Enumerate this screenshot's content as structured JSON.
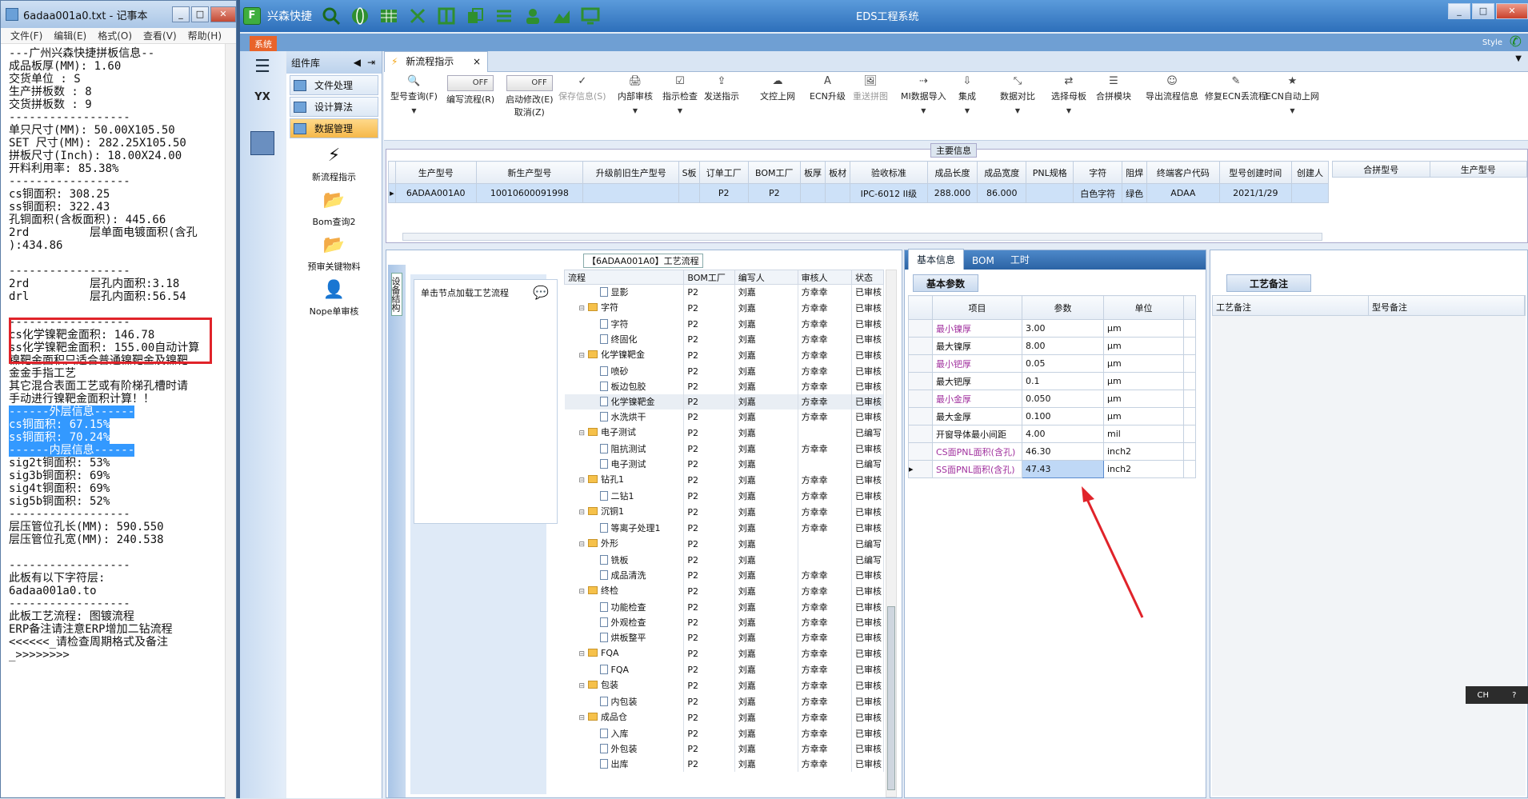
{
  "notepad": {
    "title": "6adaa001a0.txt - 记事本",
    "menu": [
      "文件(F)",
      "编辑(E)",
      "格式(O)",
      "查看(V)",
      "帮助(H)"
    ],
    "lines": [
      "---广州兴森快捷拼板信息--",
      "成品板厚(MM): 1.60",
      "交货单位 : S",
      "生产拼板数 : 8",
      "交货拼板数 : 9",
      "------------------",
      "单只尺寸(MM): 50.00X105.50",
      "SET 尺寸(MM): 282.25X105.50",
      "拼板尺寸(Inch): 18.00X24.00",
      "开料利用率: 85.38%",
      "------------------",
      "cs铜面积: 308.25",
      "ss铜面积: 322.43",
      "孔铜面积(含板面积): 445.66",
      "2rd         层单面电镀面积(含孔",
      "):434.86",
      "",
      "------------------",
      "2rd         层孔内面积:3.18",
      "drl         层孔内面积:56.54",
      "",
      "------------------",
      "cs化学镍靶金面积: 146.78",
      "ss化学镍靶金面积: 155.00自动计算",
      "镍靶金面积只适合普通镍靶金及镍靶",
      "金金手指工艺",
      "其它混合表面工艺或有阶梯孔槽时请",
      "手动进行镍靶金面积计算！！",
      "------外层信息------",
      "cs铜面积: 67.15%",
      "ss铜面积: 70.24%",
      "------内层信息------",
      "sig2t铜面积: 53%",
      "sig3b铜面积: 69%",
      "sig4t铜面积: 69%",
      "sig5b铜面积: 52%",
      "------------------",
      "层压管位孔长(MM): 590.550",
      "层压管位孔宽(MM): 240.538",
      "",
      "------------------",
      "此板有以下字符层:",
      "6adaa001a0.to",
      "------------------",
      "此板工艺流程: 图镀流程",
      "ERP备注请注意ERP增加二钻流程",
      "<<<<<<_请检查周期格式及备注",
      "_>>>>>>>>"
    ]
  },
  "app": {
    "brand": "兴森快捷",
    "title": "EDS工程系统",
    "system_tab": "系统",
    "style_label": "Style",
    "window_controls": [
      "_",
      "□",
      "✕"
    ]
  },
  "leftnav": {
    "hamburger": "☰",
    "logo": "YX"
  },
  "component_panel": {
    "header": "组件库",
    "items": [
      "文件处理",
      "设计算法",
      "数据管理"
    ],
    "tools": [
      {
        "label": "新流程指示",
        "icon": "lightning-icon"
      },
      {
        "label": "Bom查询2",
        "icon": "folder-icon"
      },
      {
        "label": "预审关键物料",
        "icon": "folder-icon"
      },
      {
        "label": "Nope单审核",
        "icon": "user-icon"
      }
    ]
  },
  "tabs": [
    {
      "label": "新流程指示"
    }
  ],
  "ribbon": {
    "buttons": [
      {
        "label": "型号查询(F)",
        "dd": true
      },
      {
        "label": "编写流程(R)",
        "toggle": "OFF"
      },
      {
        "label": "启动修改(E)",
        "sub": "取消(Z)",
        "toggle": "OFF"
      },
      {
        "label": "保存信息(S)",
        "disabled": true
      },
      {
        "label": "内部审核",
        "dd": true
      },
      {
        "label": "指示检查",
        "dd": true
      },
      {
        "label": "发送指示"
      },
      {
        "label": "文控上网"
      },
      {
        "label": "ECN升级"
      },
      {
        "label": "重送拼图",
        "disabled": true
      },
      {
        "label": "MI数据导入",
        "dd": true
      },
      {
        "label": "集成",
        "dd": true
      },
      {
        "label": "数据对比",
        "dd": true
      },
      {
        "label": "选择母板",
        "dd": true
      },
      {
        "label": "合拼模块"
      },
      {
        "label": "导出流程信息"
      },
      {
        "label": "修复ECN丢流程"
      },
      {
        "label": "ECN自动上网",
        "dd": true
      }
    ]
  },
  "main_info": {
    "label": "主要信息",
    "columns": [
      "生产型号",
      "新生产型号",
      "升级前旧生产型号",
      "S板",
      "订单工厂",
      "BOM工厂",
      "板厚",
      "板材",
      "验收标准",
      "成品长度",
      "成品宽度",
      "PNL规格",
      "字符",
      "阻焊",
      "终端客户代码",
      "型号创建时间",
      "创建人"
    ],
    "row": [
      "6ADAA001A0",
      "10010600091998",
      "",
      "",
      "P2",
      "P2",
      "",
      "",
      "IPC-6012 II级",
      "288.000",
      "86.000",
      "",
      "白色字符",
      "绿色",
      "ADAA",
      "2021/1/29",
      ""
    ],
    "side_columns": [
      "合拼型号",
      "生产型号"
    ]
  },
  "flow": {
    "title": "【6ADAA001A0】工艺流程",
    "side_tab": "设备结构",
    "tip": "单击节点加载工艺流程",
    "columns": [
      "流程",
      "BOM工厂",
      "编写人",
      "审核人",
      "状态"
    ],
    "rows": [
      {
        "name": "显影",
        "level": 2,
        "f": "P2",
        "w": "刘嘉",
        "a": "方幸幸",
        "s": "已审核"
      },
      {
        "name": "字符",
        "level": 1,
        "f": "P2",
        "w": "刘嘉",
        "a": "方幸幸",
        "s": "已审核"
      },
      {
        "name": "字符",
        "level": 2,
        "f": "P2",
        "w": "刘嘉",
        "a": "方幸幸",
        "s": "已审核"
      },
      {
        "name": "终固化",
        "level": 2,
        "f": "P2",
        "w": "刘嘉",
        "a": "方幸幸",
        "s": "已审核"
      },
      {
        "name": "化学镍靶金",
        "level": 1,
        "f": "P2",
        "w": "刘嘉",
        "a": "方幸幸",
        "s": "已审核"
      },
      {
        "name": "喷砂",
        "level": 2,
        "f": "P2",
        "w": "刘嘉",
        "a": "方幸幸",
        "s": "已审核"
      },
      {
        "name": "板边包胶",
        "level": 2,
        "f": "P2",
        "w": "刘嘉",
        "a": "方幸幸",
        "s": "已审核"
      },
      {
        "name": "化学镍靶金",
        "level": 2,
        "f": "P2",
        "w": "刘嘉",
        "a": "方幸幸",
        "s": "已审核",
        "sel": true
      },
      {
        "name": "水洗烘干",
        "level": 2,
        "f": "P2",
        "w": "刘嘉",
        "a": "方幸幸",
        "s": "已审核"
      },
      {
        "name": "电子测试",
        "level": 1,
        "f": "P2",
        "w": "刘嘉",
        "a": "",
        "s": "已编写"
      },
      {
        "name": "阻抗测试",
        "level": 2,
        "f": "P2",
        "w": "刘嘉",
        "a": "方幸幸",
        "s": "已审核"
      },
      {
        "name": "电子测试",
        "level": 2,
        "f": "P2",
        "w": "刘嘉",
        "a": "",
        "s": "已编写"
      },
      {
        "name": "钻孔1",
        "level": 1,
        "f": "P2",
        "w": "刘嘉",
        "a": "方幸幸",
        "s": "已审核"
      },
      {
        "name": "二钻1",
        "level": 2,
        "f": "P2",
        "w": "刘嘉",
        "a": "方幸幸",
        "s": "已审核"
      },
      {
        "name": "沉铜1",
        "level": 1,
        "f": "P2",
        "w": "刘嘉",
        "a": "方幸幸",
        "s": "已审核"
      },
      {
        "name": "等离子处理1",
        "level": 2,
        "f": "P2",
        "w": "刘嘉",
        "a": "方幸幸",
        "s": "已审核"
      },
      {
        "name": "外形",
        "level": 1,
        "f": "P2",
        "w": "刘嘉",
        "a": "",
        "s": "已编写"
      },
      {
        "name": "铣板",
        "level": 2,
        "f": "P2",
        "w": "刘嘉",
        "a": "",
        "s": "已编写"
      },
      {
        "name": "成品清洗",
        "level": 2,
        "f": "P2",
        "w": "刘嘉",
        "a": "方幸幸",
        "s": "已审核"
      },
      {
        "name": "终检",
        "level": 1,
        "f": "P2",
        "w": "刘嘉",
        "a": "方幸幸",
        "s": "已审核"
      },
      {
        "name": "功能检查",
        "level": 2,
        "f": "P2",
        "w": "刘嘉",
        "a": "方幸幸",
        "s": "已审核"
      },
      {
        "name": "外观检查",
        "level": 2,
        "f": "P2",
        "w": "刘嘉",
        "a": "方幸幸",
        "s": "已审核"
      },
      {
        "name": "烘板整平",
        "level": 2,
        "f": "P2",
        "w": "刘嘉",
        "a": "方幸幸",
        "s": "已审核"
      },
      {
        "name": "FQA",
        "level": 1,
        "f": "P2",
        "w": "刘嘉",
        "a": "方幸幸",
        "s": "已审核"
      },
      {
        "name": "FQA",
        "level": 2,
        "f": "P2",
        "w": "刘嘉",
        "a": "方幸幸",
        "s": "已审核"
      },
      {
        "name": "包装",
        "level": 1,
        "f": "P2",
        "w": "刘嘉",
        "a": "方幸幸",
        "s": "已审核"
      },
      {
        "name": "内包装",
        "level": 2,
        "f": "P2",
        "w": "刘嘉",
        "a": "方幸幸",
        "s": "已审核"
      },
      {
        "name": "成品仓",
        "level": 1,
        "f": "P2",
        "w": "刘嘉",
        "a": "方幸幸",
        "s": "已审核"
      },
      {
        "name": "入库",
        "level": 2,
        "f": "P2",
        "w": "刘嘉",
        "a": "方幸幸",
        "s": "已审核"
      },
      {
        "name": "外包装",
        "level": 2,
        "f": "P2",
        "w": "刘嘉",
        "a": "方幸幸",
        "s": "已审核"
      },
      {
        "name": "出库",
        "level": 2,
        "f": "P2",
        "w": "刘嘉",
        "a": "方幸幸",
        "s": "已审核"
      }
    ]
  },
  "info": {
    "tabs": [
      "基本信息",
      "BOM",
      "工时"
    ],
    "sub": "基本参数",
    "columns": [
      "项目",
      "参数",
      "单位"
    ],
    "rows": [
      {
        "k": "最小镍厚",
        "v": "3.00",
        "u": "μm",
        "p": true
      },
      {
        "k": "最大镍厚",
        "v": "8.00",
        "u": "μm",
        "p": false
      },
      {
        "k": "最小钯厚",
        "v": "0.05",
        "u": "μm",
        "p": true
      },
      {
        "k": "最大钯厚",
        "v": "0.1",
        "u": "μm",
        "p": false
      },
      {
        "k": "最小金厚",
        "v": "0.050",
        "u": "μm",
        "p": true
      },
      {
        "k": "最大金厚",
        "v": "0.100",
        "u": "μm",
        "p": false
      },
      {
        "k": "开窗导体最小间距",
        "v": "4.00",
        "u": "mil",
        "p": false
      },
      {
        "k": "CS面PNL面积(含孔)",
        "v": "46.30",
        "u": "inch2",
        "p": true
      },
      {
        "k": "SS面PNL面积(含孔)",
        "v": "47.43",
        "u": "inch2",
        "p": true,
        "sel": true
      }
    ]
  },
  "notes": {
    "sub": "工艺备注",
    "columns": [
      "工艺备注",
      "型号备注"
    ]
  },
  "ime": {
    "label": "CH"
  }
}
